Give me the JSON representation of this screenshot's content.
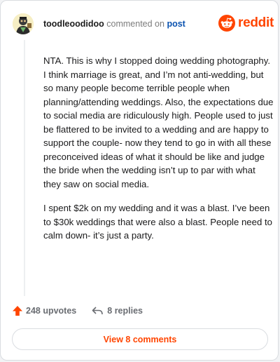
{
  "comment": {
    "username": "toodleoodidoo",
    "commented_on": "commented on",
    "post_link": "post",
    "paragraphs": [
      "NTA. This is why I stopped doing wedding photography. I think marriage is great, and I’m not anti-wedding, but so many people become terrible people when planning/attending weddings. Also, the expectations due to social media are ridiculously high. People used to just be flattered to be invited to a wedding and are happy to support the couple- now they tend to go in with all these preconceived ideas of what it should be like and judge the bride when the wedding isn’t up to par with what they saw on social media.",
      "I spent $2k on my wedding and it was a blast. I’ve been to $30k weddings that were also a blast. People need to calm down- it’s just a party."
    ]
  },
  "brand": {
    "wordmark": "reddit",
    "color": "#ff4500"
  },
  "actions": {
    "upvotes_label": "248 upvotes",
    "replies_label": "8 replies",
    "view_comments_label": "View 8 comments"
  },
  "icons": {
    "upvote": "upvote-arrow-icon",
    "reply": "reply-arrow-icon",
    "reddit": "reddit-snoo-icon",
    "avatar": "user-avatar"
  }
}
